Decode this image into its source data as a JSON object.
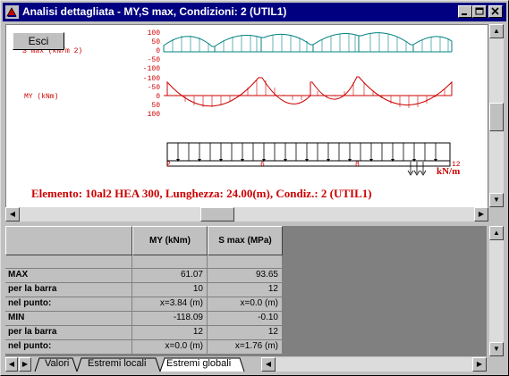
{
  "window": {
    "title": "Analisi dettagliata - MY,S max, Condizioni: 2 (UTIL1)"
  },
  "toolbar": {
    "exit_label": "Esci"
  },
  "plot": {
    "top_label": "S max  (kN/m 2)",
    "my_label": "MY  (kNm)",
    "smax_axis_ticks": [
      "100",
      "50",
      "0",
      "-50",
      "-100"
    ],
    "my_axis_ticks": [
      "-100",
      "-50",
      "0",
      "50",
      "100"
    ],
    "load_labels": [
      "2",
      "6",
      "8",
      "12"
    ],
    "load_unit": "kN/m",
    "info": "Elemento: 10al2   HEA 300, Lunghezza: 24.00(m), Condiz.: 2 (UTIL1)",
    "colors": {
      "smax": "#008080",
      "my": "#cc0000",
      "info": "#cc0000"
    }
  },
  "table": {
    "columns": [
      "MY (kNm)",
      "S max (MPa)"
    ],
    "rows": [
      {
        "label": "",
        "values": [
          "",
          ""
        ]
      },
      {
        "label": "MAX",
        "values": [
          "61.07",
          "93.65"
        ]
      },
      {
        "label": "per la barra",
        "values": [
          "10",
          "12"
        ]
      },
      {
        "label": "nel punto:",
        "values": [
          "x=3.84 (m)",
          "x=0.0 (m)"
        ]
      },
      {
        "label": "MIN",
        "values": [
          "-118.09",
          "-0.10"
        ]
      },
      {
        "label": "per la barra",
        "values": [
          "12",
          "12"
        ]
      },
      {
        "label": "nel punto:",
        "values": [
          "x=0.0 (m)",
          "x=1.76 (m)"
        ]
      }
    ]
  },
  "tabs": [
    {
      "label": "Valori",
      "active": false
    },
    {
      "label": "Estremi locali",
      "active": false
    },
    {
      "label": "Estremi globali",
      "active": true
    }
  ]
}
